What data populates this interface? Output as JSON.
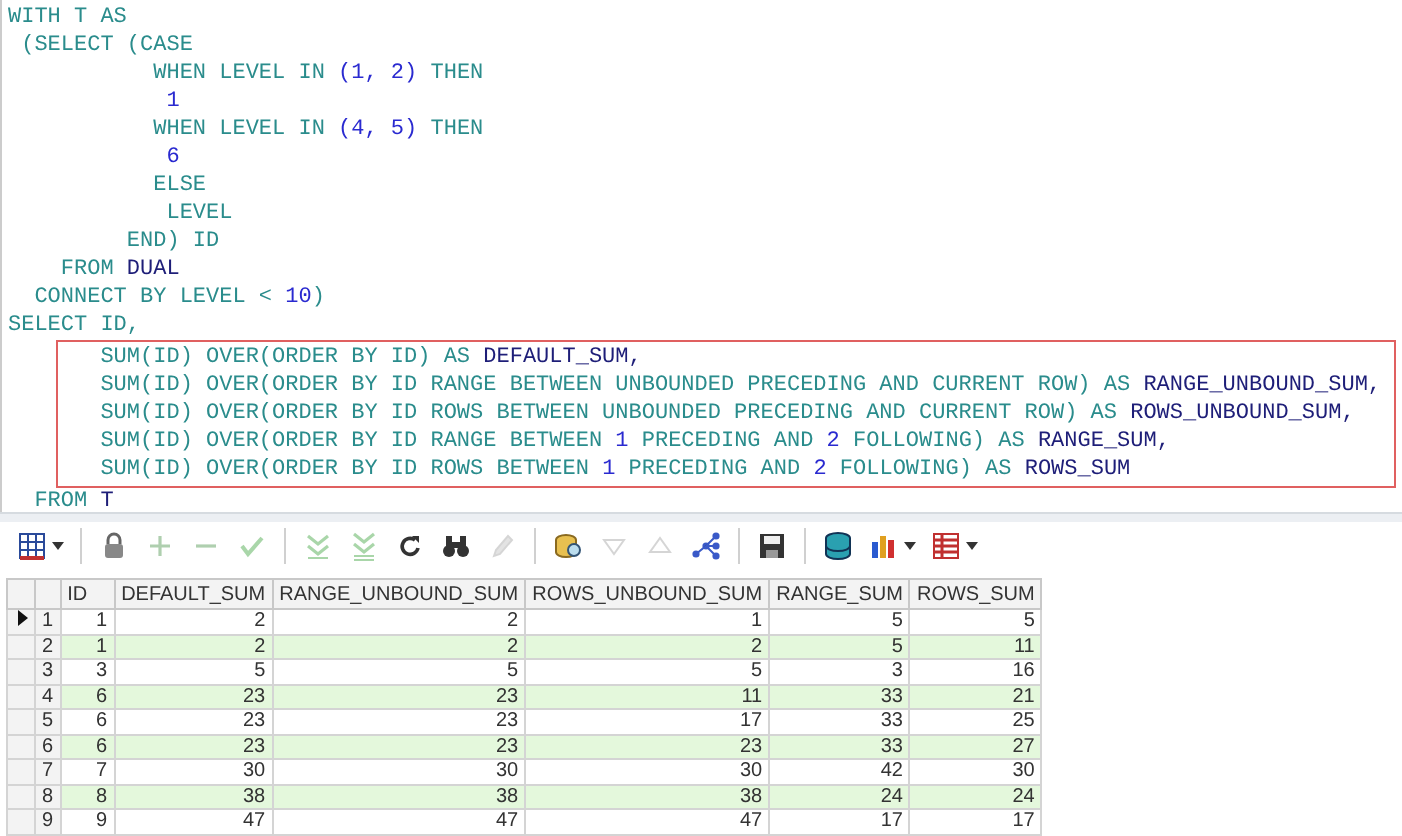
{
  "editor": {
    "blocks": [
      {
        "kind": "plain",
        "lines": [
          [
            {
              "kind": "keyword",
              "text": "WITH T AS"
            }
          ],
          [
            {
              "kind": "keyword",
              "text": " (SELECT (CASE"
            }
          ],
          [
            {
              "kind": "keyword",
              "text": "           WHEN LEVEL IN "
            },
            {
              "kind": "number",
              "text": "(1, 2)"
            },
            {
              "kind": "keyword",
              "text": " THEN"
            }
          ],
          [
            {
              "kind": "number",
              "text": "            1"
            }
          ],
          [
            {
              "kind": "keyword",
              "text": "           WHEN LEVEL IN "
            },
            {
              "kind": "number",
              "text": "(4, 5)"
            },
            {
              "kind": "keyword",
              "text": " THEN"
            }
          ],
          [
            {
              "kind": "number",
              "text": "            6"
            }
          ],
          [
            {
              "kind": "keyword",
              "text": "           ELSE"
            }
          ],
          [
            {
              "kind": "keyword",
              "text": "            LEVEL"
            }
          ],
          [
            {
              "kind": "keyword",
              "text": "         END) ID"
            }
          ],
          [
            {
              "kind": "keyword",
              "text": "    FROM "
            },
            {
              "kind": "alias",
              "text": "DUAL"
            }
          ],
          [
            {
              "kind": "keyword",
              "text": "  CONNECT BY LEVEL < "
            },
            {
              "kind": "number",
              "text": "10"
            },
            {
              "kind": "keyword",
              "text": ")"
            }
          ],
          [
            {
              "kind": "keyword",
              "text": "SELECT ID,"
            }
          ]
        ]
      },
      {
        "kind": "highlighted",
        "lines": [
          [
            {
              "kind": "keyword",
              "text": "       SUM(ID) OVER(ORDER BY ID) AS "
            },
            {
              "kind": "alias",
              "text": "DEFAULT_SUM,"
            }
          ],
          [
            {
              "kind": "keyword",
              "text": "       SUM(ID) OVER(ORDER BY ID RANGE BETWEEN UNBOUNDED PRECEDING AND CURRENT ROW) AS "
            },
            {
              "kind": "alias",
              "text": "RANGE_UNBOUND_SUM,"
            }
          ],
          [
            {
              "kind": "keyword",
              "text": "       SUM(ID) OVER(ORDER BY ID ROWS BETWEEN UNBOUNDED PRECEDING AND CURRENT ROW) AS "
            },
            {
              "kind": "alias",
              "text": "ROWS_UNBOUND_SUM,"
            }
          ],
          [
            {
              "kind": "keyword",
              "text": "       SUM(ID) OVER(ORDER BY ID RANGE BETWEEN "
            },
            {
              "kind": "number",
              "text": "1"
            },
            {
              "kind": "keyword",
              "text": " PRECEDING AND "
            },
            {
              "kind": "number",
              "text": "2"
            },
            {
              "kind": "keyword",
              "text": " FOLLOWING) AS "
            },
            {
              "kind": "alias",
              "text": "RANGE_SUM,"
            }
          ],
          [
            {
              "kind": "keyword",
              "text": "       SUM(ID) OVER(ORDER BY ID ROWS BETWEEN "
            },
            {
              "kind": "number",
              "text": "1"
            },
            {
              "kind": "keyword",
              "text": " PRECEDING AND "
            },
            {
              "kind": "number",
              "text": "2"
            },
            {
              "kind": "keyword",
              "text": " FOLLOWING) AS "
            },
            {
              "kind": "alias",
              "text": "ROWS_SUM"
            }
          ]
        ]
      },
      {
        "kind": "plain",
        "lines": [
          [
            {
              "kind": "keyword",
              "text": "  FROM "
            },
            {
              "kind": "alias",
              "text": "T"
            }
          ]
        ]
      }
    ]
  },
  "toolbar": [
    {
      "kind": "grid",
      "dropdown": true,
      "disabled": false
    },
    {
      "kind": "separator"
    },
    {
      "kind": "lock",
      "dropdown": false,
      "disabled": false
    },
    {
      "kind": "add",
      "dropdown": false,
      "disabled": true
    },
    {
      "kind": "remove",
      "dropdown": false,
      "disabled": true
    },
    {
      "kind": "check",
      "dropdown": false,
      "disabled": true
    },
    {
      "kind": "separator"
    },
    {
      "kind": "fetch-next",
      "dropdown": false,
      "disabled": true
    },
    {
      "kind": "fetch-all",
      "dropdown": false,
      "disabled": true
    },
    {
      "kind": "refresh",
      "dropdown": false,
      "disabled": false
    },
    {
      "kind": "find",
      "dropdown": false,
      "disabled": false
    },
    {
      "kind": "clear",
      "dropdown": false,
      "disabled": true
    },
    {
      "kind": "separator"
    },
    {
      "kind": "query",
      "dropdown": false,
      "disabled": false
    },
    {
      "kind": "down",
      "dropdown": false,
      "disabled": true
    },
    {
      "kind": "up",
      "dropdown": false,
      "disabled": true
    },
    {
      "kind": "tree",
      "dropdown": false,
      "disabled": false
    },
    {
      "kind": "separator"
    },
    {
      "kind": "save",
      "dropdown": false,
      "disabled": false
    },
    {
      "kind": "separator"
    },
    {
      "kind": "database",
      "dropdown": false,
      "disabled": false
    },
    {
      "kind": "chart",
      "dropdown": true,
      "disabled": false
    },
    {
      "kind": "table",
      "dropdown": true,
      "disabled": false
    }
  ],
  "grid": {
    "columns": [
      "ID",
      "DEFAULT_SUM",
      "RANGE_UNBOUND_SUM",
      "ROWS_UNBOUND_SUM",
      "RANGE_SUM",
      "ROWS_SUM"
    ],
    "rows": [
      {
        "number": "1",
        "selected": true,
        "cells": [
          "1",
          "2",
          "2",
          "1",
          "5",
          "5"
        ]
      },
      {
        "number": "2",
        "selected": false,
        "cells": [
          "1",
          "2",
          "2",
          "2",
          "5",
          "11"
        ]
      },
      {
        "number": "3",
        "selected": false,
        "cells": [
          "3",
          "5",
          "5",
          "5",
          "3",
          "16"
        ]
      },
      {
        "number": "4",
        "selected": false,
        "cells": [
          "6",
          "23",
          "23",
          "11",
          "33",
          "21"
        ]
      },
      {
        "number": "5",
        "selected": false,
        "cells": [
          "6",
          "23",
          "23",
          "17",
          "33",
          "25"
        ]
      },
      {
        "number": "6",
        "selected": false,
        "cells": [
          "6",
          "23",
          "23",
          "23",
          "33",
          "27"
        ]
      },
      {
        "number": "7",
        "selected": false,
        "cells": [
          "7",
          "30",
          "30",
          "30",
          "42",
          "30"
        ]
      },
      {
        "number": "8",
        "selected": false,
        "cells": [
          "8",
          "38",
          "38",
          "38",
          "24",
          "24"
        ]
      },
      {
        "number": "9",
        "selected": false,
        "cells": [
          "9",
          "47",
          "47",
          "47",
          "17",
          "17"
        ]
      }
    ]
  }
}
